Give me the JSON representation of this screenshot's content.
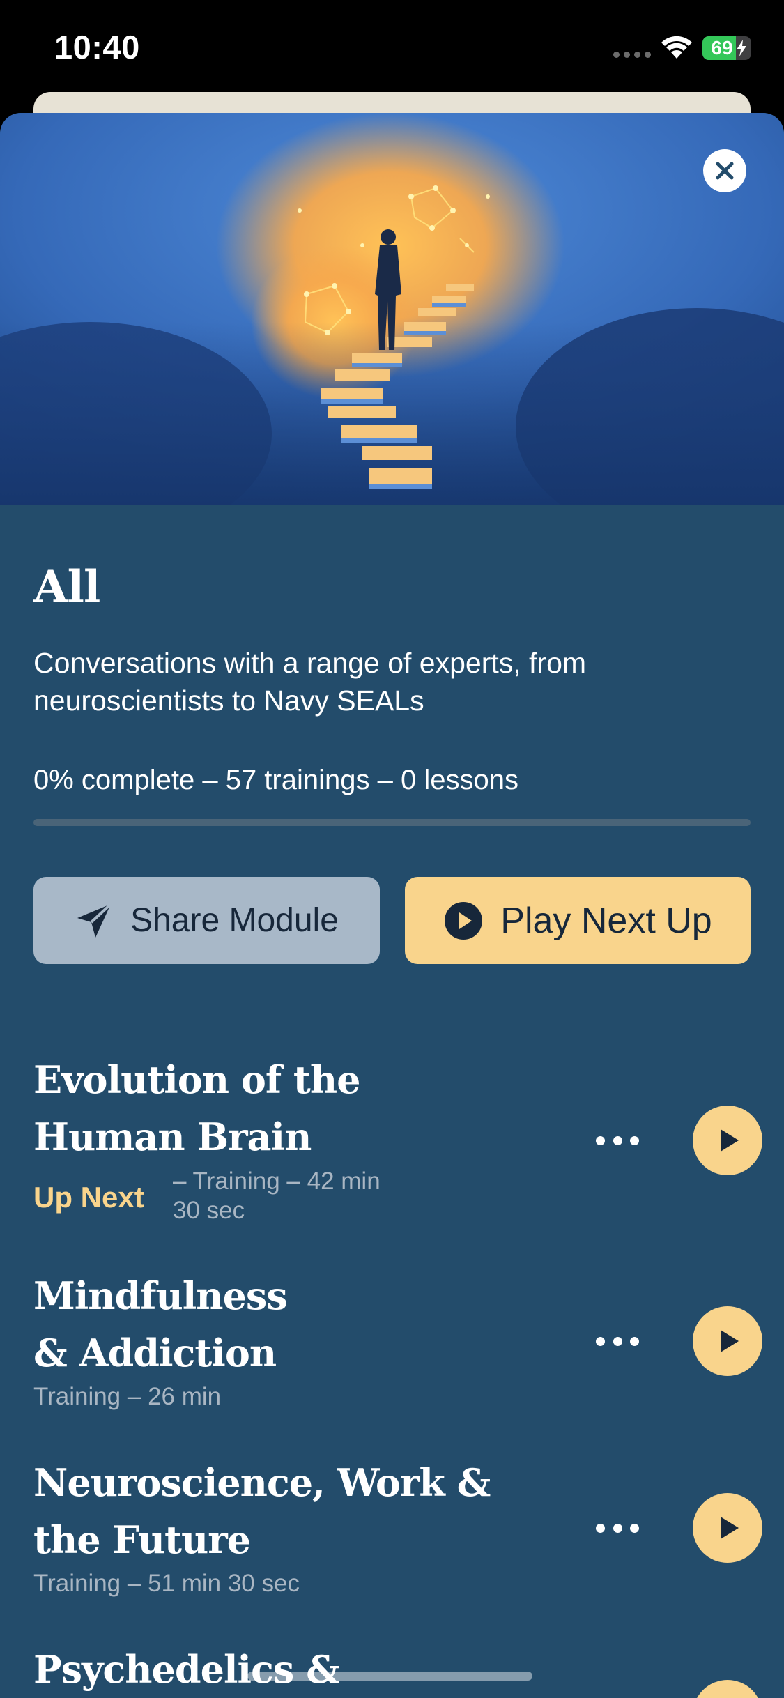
{
  "status_bar": {
    "time": "10:40",
    "battery_text": "69",
    "battery_level": 0.69,
    "icons": [
      "signal-icon",
      "wifi-icon",
      "battery-icon"
    ]
  },
  "hero": {
    "close_icon": "close-icon",
    "image": "person-on-spiral-staircase-illustration"
  },
  "module": {
    "title": "All",
    "description": "Conversations with a range of experts, from neuroscientists to Navy SEALs",
    "progress_text": "0% complete – 57 trainings – 0 lessons",
    "progress_fraction": 0
  },
  "actions": {
    "share_label": "Share Module",
    "share_icon": "paper-plane-icon",
    "play_label": "Play Next Up",
    "play_icon": "play-circle-icon"
  },
  "trainings": [
    {
      "title_line1": "Evolution of the",
      "title_line2": "Human Brain",
      "badge": "Up Next",
      "meta_line1": "– Training – 42 min",
      "meta_line2": "30 sec"
    },
    {
      "title_line1": "Mindfulness",
      "title_line2": "& Addiction",
      "meta": "Training – 26 min"
    },
    {
      "title_line1": "Neuroscience, Work &",
      "title_line2": "the Future",
      "meta": "Training – 51 min 30 sec"
    },
    {
      "title_line1": "Psychedelics &"
    }
  ],
  "colors": {
    "sheet_background": "#234c6b",
    "accent": "#f9d48c",
    "share_button": "#a8b8c8",
    "meta_text": "#a9b6c3"
  }
}
